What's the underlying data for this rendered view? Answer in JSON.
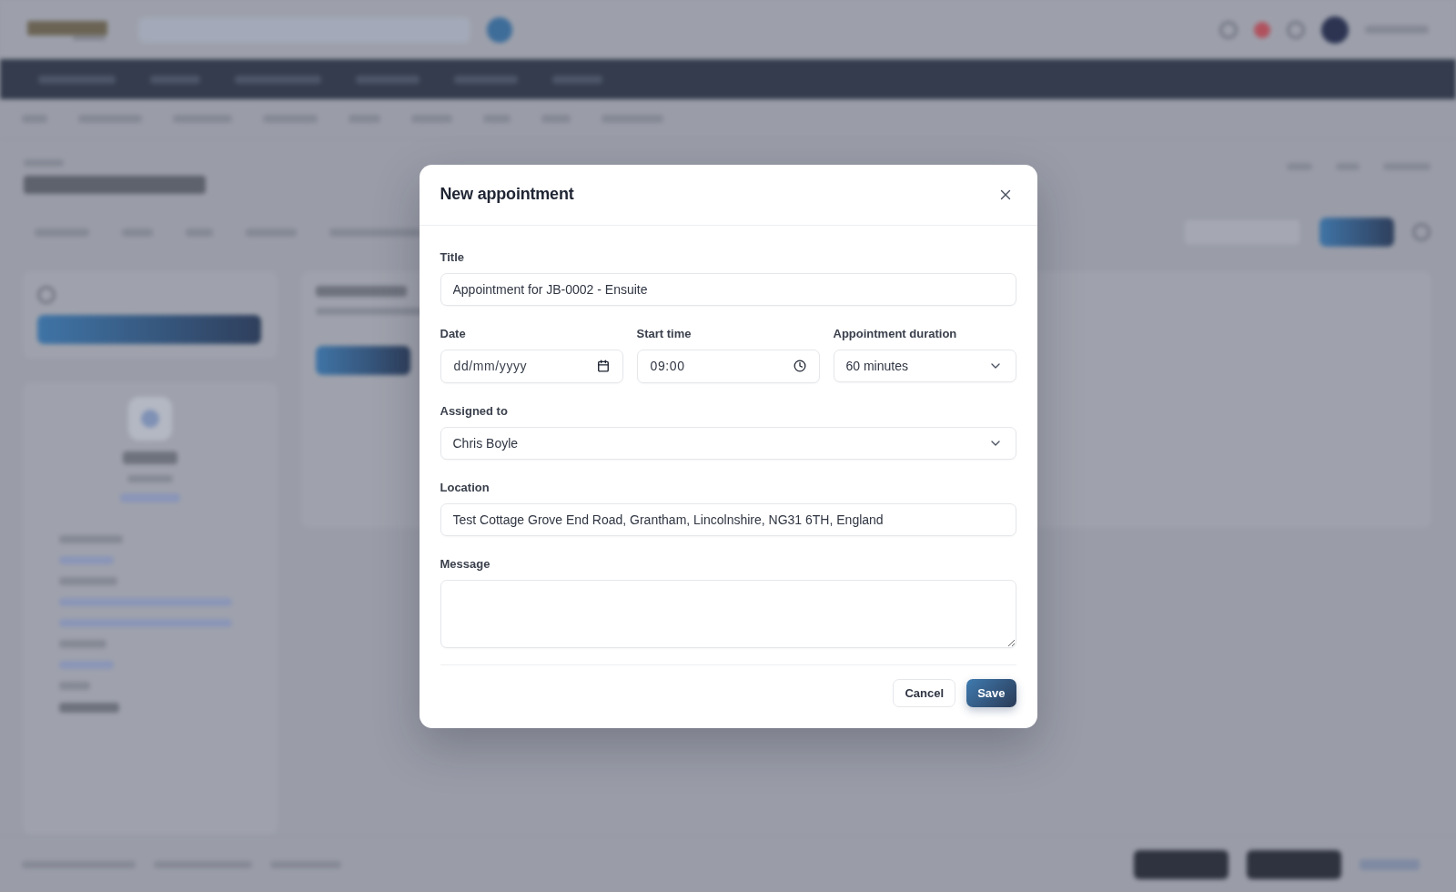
{
  "dialog": {
    "title": "New appointment",
    "rows": [
      [
        {
          "kind": "text",
          "label": "Title",
          "value": "Appointment for JB-0002 - Ensuite"
        }
      ],
      [
        {
          "kind": "date",
          "label": "Date",
          "placeholder": "dd/mm/yyyy"
        },
        {
          "kind": "time",
          "label": "Start time",
          "value": "09:00"
        },
        {
          "kind": "select",
          "label": "Appointment duration",
          "value": "60 minutes"
        }
      ],
      [
        {
          "kind": "select",
          "label": "Assigned to",
          "value": "Chris Boyle"
        }
      ],
      [
        {
          "kind": "text",
          "label": "Location",
          "value": "Test Cottage Grove End Road, Grantham, Lincolnshire, NG31 6TH, England"
        }
      ],
      [
        {
          "kind": "textarea",
          "label": "Message"
        }
      ]
    ],
    "buttons": [
      {
        "kind": "secondary",
        "label": "Cancel"
      },
      {
        "kind": "primary",
        "label": "Save"
      }
    ]
  }
}
